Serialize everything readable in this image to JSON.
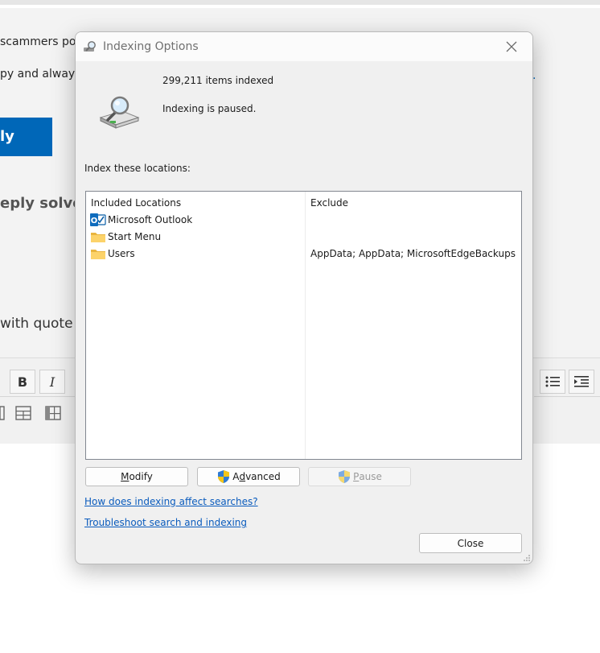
{
  "background": {
    "line1": "scammers post",
    "line2": "py and always",
    "link_dot": ".",
    "reply_button": "ly",
    "heading": "eply solve y",
    "quote_label": "with quote",
    "toolbar": {
      "bold": "B",
      "italic": "I"
    }
  },
  "dialog": {
    "title": "Indexing Options",
    "items_indexed": "299,211 items indexed",
    "status": "Indexing is paused.",
    "index_label": "Index these locations:",
    "columns": {
      "included": "Included Locations",
      "exclude": "Exclude"
    },
    "locations": [
      {
        "name": "Microsoft Outlook",
        "icon": "outlook-icon",
        "exclude": ""
      },
      {
        "name": "Start Menu",
        "icon": "folder-icon",
        "exclude": ""
      },
      {
        "name": "Users",
        "icon": "folder-icon",
        "exclude": "AppData; AppData; MicrosoftEdgeBackups"
      }
    ],
    "buttons": {
      "modify_prefix": "",
      "modify_key": "M",
      "modify_rest": "odify",
      "advanced_prefix": "A",
      "advanced_key": "d",
      "advanced_rest": "vanced",
      "pause_key": "P",
      "pause_rest": "ause",
      "close": "Close"
    },
    "links": {
      "how_indexing": "How does indexing affect searches?",
      "troubleshoot": "Troubleshoot search and indexing"
    }
  }
}
